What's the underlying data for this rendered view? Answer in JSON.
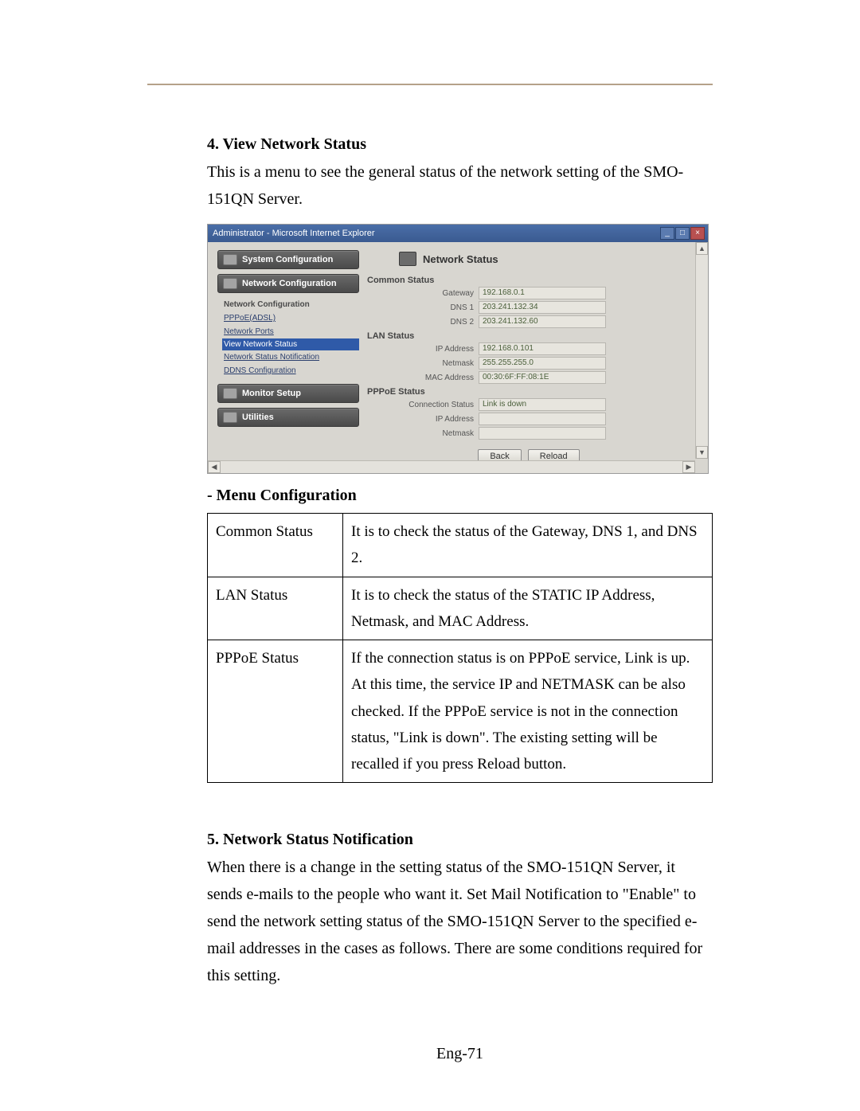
{
  "section4": {
    "heading": "4. View Network Status",
    "intro": "This is a menu to see the general status of the network setting of the SMO-151QN Server."
  },
  "screenshot": {
    "window_title": "Administrator - Microsoft Internet Explorer",
    "win_min": "_",
    "win_max": "□",
    "win_close": "×",
    "sidebar": {
      "system_config": "System Configuration",
      "network_config": "Network Configuration",
      "nc_header": "Network Configuration",
      "pppoe": "PPPoE(ADSL)",
      "network_ports": "Network Ports",
      "view_network_status": "View Network Status",
      "net_status_notif": "Network Status Notification",
      "ddns_config": "DDNS Configuration",
      "monitor_setup": "Monitor Setup",
      "utilities": "Utilities"
    },
    "panel": {
      "title": "Network Status",
      "common_status_label": "Common Status",
      "gateway_label": "Gateway",
      "gateway_value": "192.168.0.1",
      "dns1_label": "DNS 1",
      "dns1_value": "203.241.132.34",
      "dns2_label": "DNS 2",
      "dns2_value": "203.241.132.60",
      "lan_status_label": "LAN Status",
      "ip_label": "IP Address",
      "ip_value": "192.168.0.101",
      "netmask_label": "Netmask",
      "netmask_value": "255.255.255.0",
      "mac_label": "MAC Address",
      "mac_value": "00:30:6F:FF:08:1E",
      "pppoe_status_label": "PPPoE Status",
      "conn_status_label": "Connection Status",
      "conn_status_value": "Link is down",
      "pppoe_ip_label": "IP Address",
      "pppoe_ip_value": "",
      "pppoe_netmask_label": "Netmask",
      "pppoe_netmask_value": "",
      "back_btn": "Back",
      "reload_btn": "Reload"
    }
  },
  "menu_config": {
    "heading": "- Menu Configuration",
    "rows": {
      "common_label": "Common Status",
      "common_desc": "It is to check the status of the Gateway, DNS 1, and DNS 2.",
      "lan_label": "LAN Status",
      "lan_desc": "It is to check the status of the STATIC IP Address, Netmask, and MAC Address.",
      "pppoe_label": "PPPoE Status",
      "pppoe_desc": "If the connection status is on PPPoE service, Link is up. At this time, the service IP and NETMASK can be also checked. If the PPPoE service is not in the connection status, \"Link is down\". The existing setting will be recalled if you press Reload button."
    }
  },
  "section5": {
    "heading": "5. Network Status Notification",
    "body": "When there is a change in the setting status of the SMO-151QN Server, it sends e-mails to the people who want it. Set Mail Notification to \"Enable\" to send the network setting status of the SMO-151QN Server to the specified e-mail addresses in the cases as follows. There are some conditions required for this setting."
  },
  "page_number": "Eng-71"
}
